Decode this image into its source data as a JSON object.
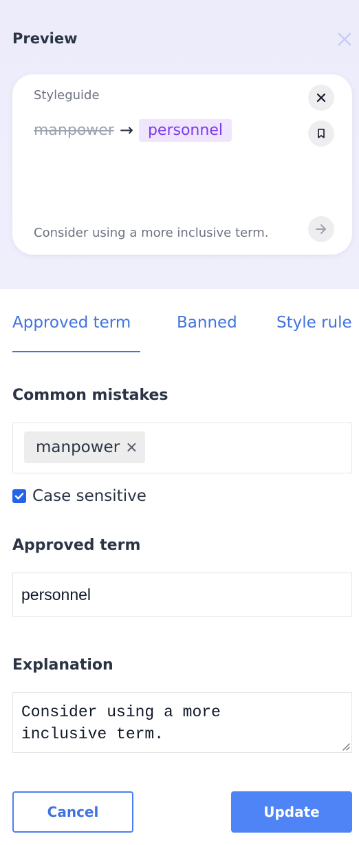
{
  "preview": {
    "title": "Preview",
    "close_icon": "close-icon",
    "card": {
      "category": "Styleguide",
      "mistake": "manpower",
      "arrow": "→",
      "replacement": "personnel",
      "explanation": "Consider using a more inclusive term.",
      "replacement_color": "#7c3aed",
      "replacement_bg": "#efe6fd"
    }
  },
  "tabs": [
    {
      "label": "Approved term",
      "active": true
    },
    {
      "label": "Banned",
      "active": false
    },
    {
      "label": "Style rule",
      "active": false
    }
  ],
  "form": {
    "common_mistakes_label": "Common mistakes",
    "mistakes": [
      {
        "text": "manpower",
        "remove": "×"
      }
    ],
    "case_sensitive_label": "Case sensitive",
    "case_sensitive_checked": true,
    "approved_term_label": "Approved term",
    "approved_term_value": "personnel",
    "explanation_label": "Explanation",
    "explanation_value": "Consider using a more\ninclusive term."
  },
  "actions": {
    "cancel_label": "Cancel",
    "update_label": "Update"
  },
  "colors": {
    "accent": "#3f73df",
    "primary_button": "#4f84f6",
    "preview_bg": "#ececfb"
  }
}
